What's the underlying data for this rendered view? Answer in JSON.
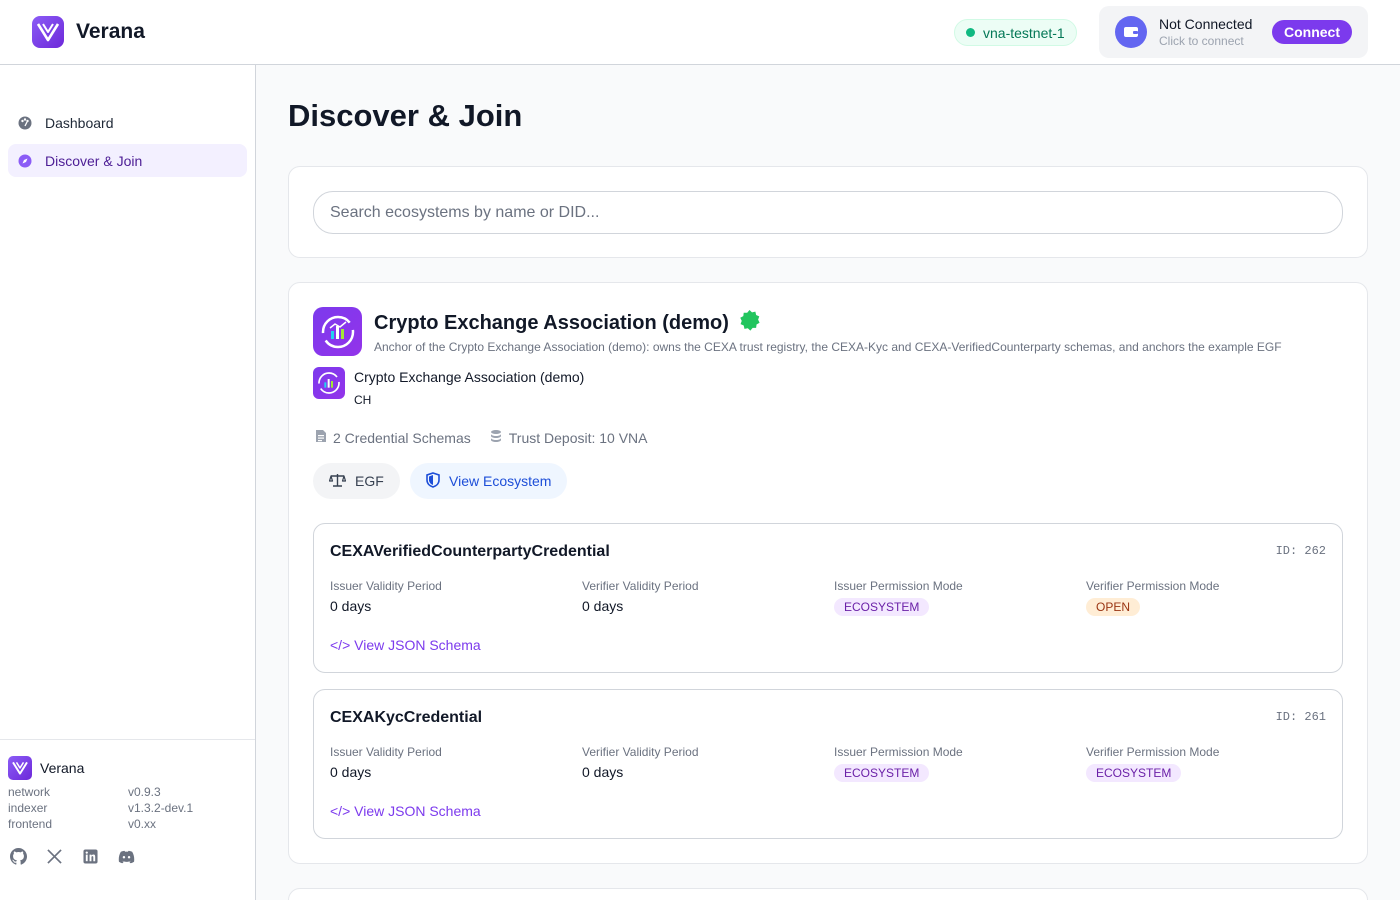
{
  "app": {
    "name": "Verana"
  },
  "header": {
    "network_pill": "vna-testnet-1",
    "wallet": {
      "title": "Not Connected",
      "subtitle": "Click to connect",
      "connect_label": "Connect"
    }
  },
  "sidebar": {
    "items": [
      {
        "label": "Dashboard",
        "icon": "dashboard-icon",
        "active": false
      },
      {
        "label": "Discover & Join",
        "icon": "compass-icon",
        "active": true
      }
    ],
    "footer": {
      "brand": "Verana",
      "versions": [
        {
          "label": "network",
          "value": "v0.9.3"
        },
        {
          "label": "indexer",
          "value": "v1.3.2-dev.1"
        },
        {
          "label": "frontend",
          "value": "v0.xx"
        }
      ],
      "social_icons": [
        "github-icon",
        "x-icon",
        "linkedin-icon",
        "discord-icon"
      ]
    }
  },
  "main": {
    "title": "Discover & Join",
    "search": {
      "placeholder": "Search ecosystems by name or DID...",
      "value": ""
    },
    "ecosystem": {
      "name": "Crypto Exchange Association (demo)",
      "verified_icon": "verified-badge-icon",
      "description": "Anchor of the Crypto Exchange Association (demo): owns the CEXA trust registry, the CEXA-Kyc and CEXA-VerifiedCounterparty schemas, and anchors the example EGF",
      "org_name": "Crypto Exchange Association (demo)",
      "org_country": "CH",
      "schemas_count": "2 Credential Schemas",
      "trust_deposit": "Trust Deposit: 10 VNA",
      "egf_label": "EGF",
      "view_label": "View Ecosystem",
      "schemas": [
        {
          "name": "CEXAVerifiedCounterpartyCredential",
          "id": "ID: 262",
          "issuer_validity_label": "Issuer Validity Period",
          "issuer_validity": "0 days",
          "verifier_validity_label": "Verifier Validity Period",
          "verifier_validity": "0 days",
          "issuer_mode_label": "Issuer Permission Mode",
          "issuer_mode": "ECOSYSTEM",
          "verifier_mode_label": "Verifier Permission Mode",
          "verifier_mode": "OPEN",
          "link": "</> View JSON Schema"
        },
        {
          "name": "CEXAKycCredential",
          "id": "ID: 261",
          "issuer_validity_label": "Issuer Validity Period",
          "issuer_validity": "0 days",
          "verifier_validity_label": "Verifier Validity Period",
          "verifier_validity": "0 days",
          "issuer_mode_label": "Issuer Permission Mode",
          "issuer_mode": "ECOSYSTEM",
          "verifier_mode_label": "Verifier Permission Mode",
          "verifier_mode": "ECOSYSTEM",
          "link": "</> View JSON Schema"
        }
      ]
    }
  },
  "colors": {
    "accent": "#7c3aed",
    "network_green": "#10b981",
    "link_blue": "#1d4ed8"
  }
}
